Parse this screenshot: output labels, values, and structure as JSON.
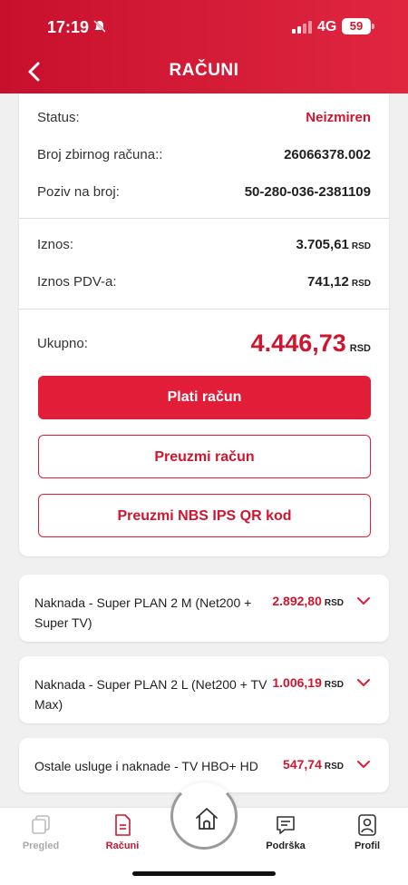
{
  "status_bar": {
    "time": "17:19",
    "network": "4G",
    "battery": "59"
  },
  "header": {
    "title": "RAČUNI"
  },
  "details": {
    "status_label": "Status:",
    "status_value": "Neizmiren",
    "bill_label": "Broj zbirnog računa::",
    "bill_value": "26066378.002",
    "ref_label": "Poziv na broj:",
    "ref_value": "50-280-036-2381109",
    "amount_label": "Iznos:",
    "amount_value": "3.705,61",
    "vat_label": "Iznos PDV-a:",
    "vat_value": "741,12",
    "total_label": "Ukupno:",
    "total_value": "4.446,73",
    "currency": "RSD"
  },
  "actions": {
    "pay": "Plati račun",
    "download": "Preuzmi račun",
    "qr": "Preuzmi NBS IPS QR kod"
  },
  "items": [
    {
      "title": "Naknada - Super PLAN 2 M (Net200 + Super TV)",
      "price": "2.892,80",
      "currency": "RSD"
    },
    {
      "title": "Naknada - Super PLAN 2 L (Net200 + TV Max)",
      "price": "1.006,19",
      "currency": "RSD"
    },
    {
      "title": "Ostale usluge i naknade - TV HBO+ HD",
      "price": "547,74",
      "currency": "RSD"
    }
  ],
  "tabbar": {
    "overview": "Pregled",
    "bills": "Računi",
    "support": "Podrška",
    "profile": "Profil"
  },
  "colors": {
    "accent": "#e11d38",
    "header": "#d0162f"
  }
}
